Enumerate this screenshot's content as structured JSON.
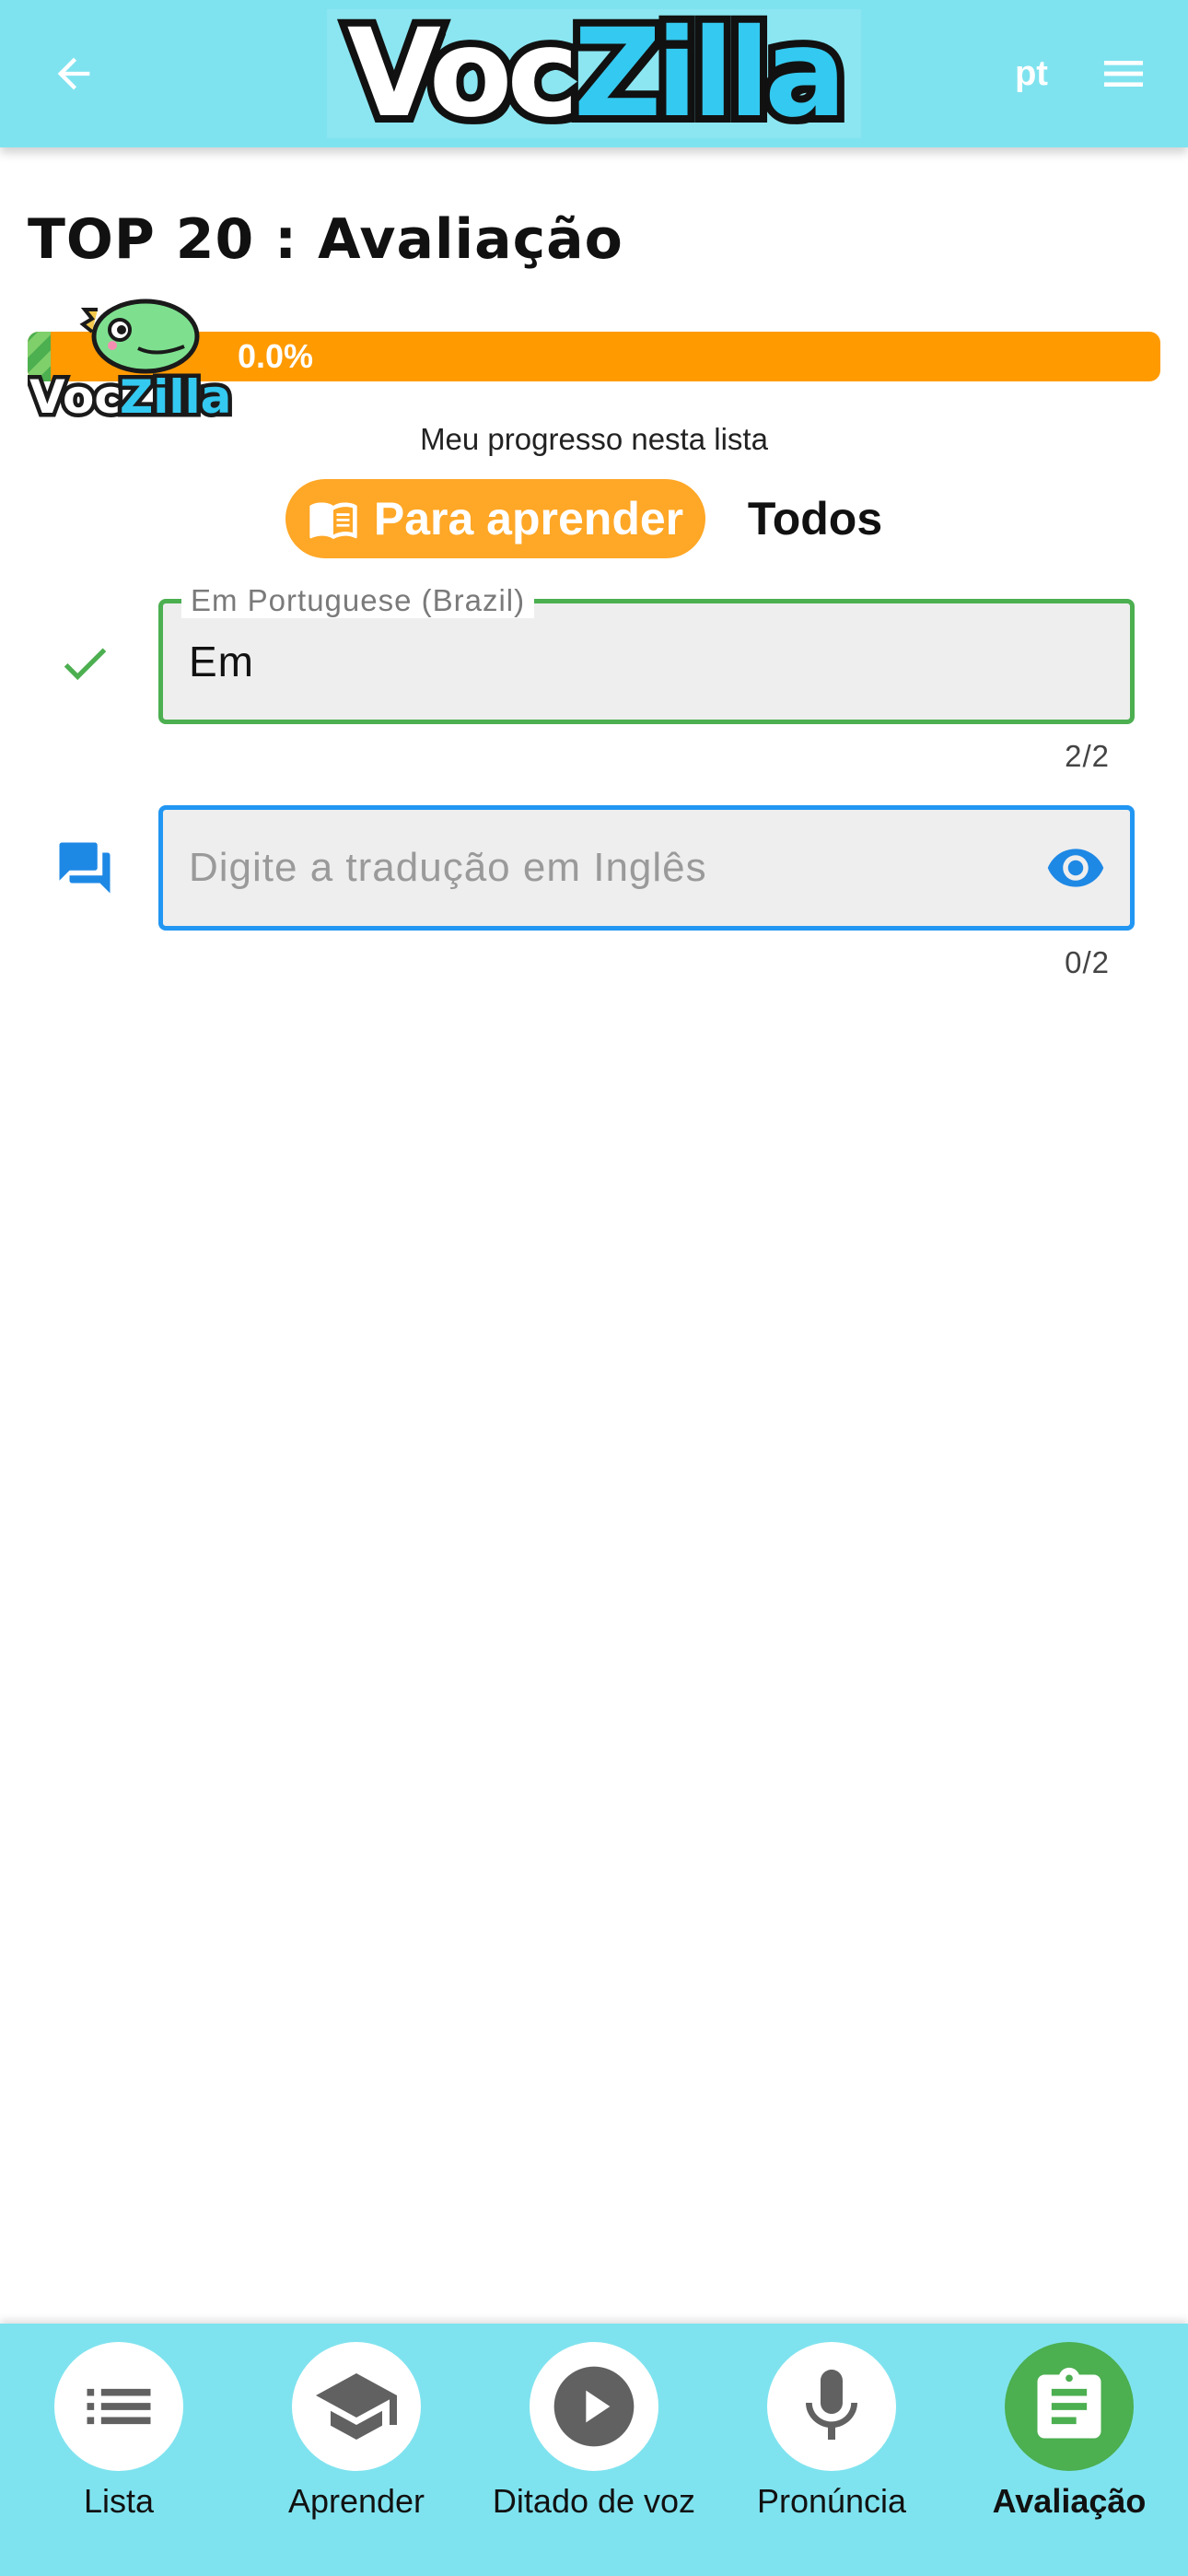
{
  "header": {
    "logo_voc": "Voc",
    "logo_zilla": "Zilla",
    "language": "pt",
    "back_icon": "arrow-left-icon",
    "menu_icon": "hamburger-menu-icon",
    "background_color": "#7fe3ef"
  },
  "page": {
    "title": "TOP 20 : Avaliação"
  },
  "progress": {
    "value_percent": 0.0,
    "label": "0.0%",
    "caption": "Meu progresso nesta lista",
    "track_color": "#ff9a00",
    "fill_color": "#4caf50",
    "mascot_text_voc": "Voc",
    "mascot_text_zilla": "Zilla"
  },
  "filter": {
    "options": [
      {
        "label": "Para aprender",
        "icon": "book-open-icon",
        "active": true
      },
      {
        "label": "Todos",
        "icon": "",
        "active": false
      }
    ],
    "active_color": "#ffa726"
  },
  "fields": {
    "source": {
      "label": "Em Portuguese (Brazil)",
      "value": "Em",
      "counter": "2/2",
      "status_icon": "check-icon",
      "border_color": "#4caf50"
    },
    "answer": {
      "placeholder": "Digite a tradução em Inglês",
      "value": "",
      "counter": "0/2",
      "status_icon": "chat-bubbles-icon",
      "action_icon": "eye-icon",
      "border_color": "#2196f3"
    }
  },
  "bottom_nav": {
    "items": [
      {
        "label": "Lista",
        "icon": "list-icon",
        "active": false
      },
      {
        "label": "Aprender",
        "icon": "graduation-cap-icon",
        "active": false
      },
      {
        "label": "Ditado de voz",
        "icon": "play-circle-icon",
        "active": false
      },
      {
        "label": "Pronúncia",
        "icon": "microphone-icon",
        "active": false
      },
      {
        "label": "Avaliação",
        "icon": "clipboard-icon",
        "active": true
      }
    ],
    "active_color": "#4caf50"
  }
}
